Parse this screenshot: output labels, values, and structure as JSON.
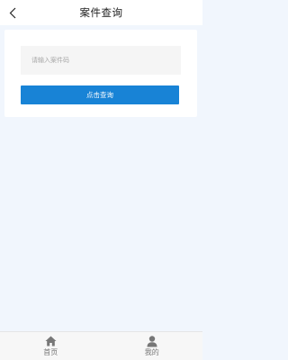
{
  "header": {
    "title": "案件查询",
    "back_icon": "chevron-left-icon"
  },
  "search": {
    "placeholder": "请输入案件码",
    "value": "",
    "button_label": "点击查询"
  },
  "tabbar": {
    "items": [
      {
        "label": "首页",
        "icon": "home-icon"
      },
      {
        "label": "我的",
        "icon": "user-icon"
      }
    ]
  },
  "colors": {
    "accent": "#1883d6",
    "page_background": "#f1f6fd",
    "tab_icon": "#777777"
  }
}
